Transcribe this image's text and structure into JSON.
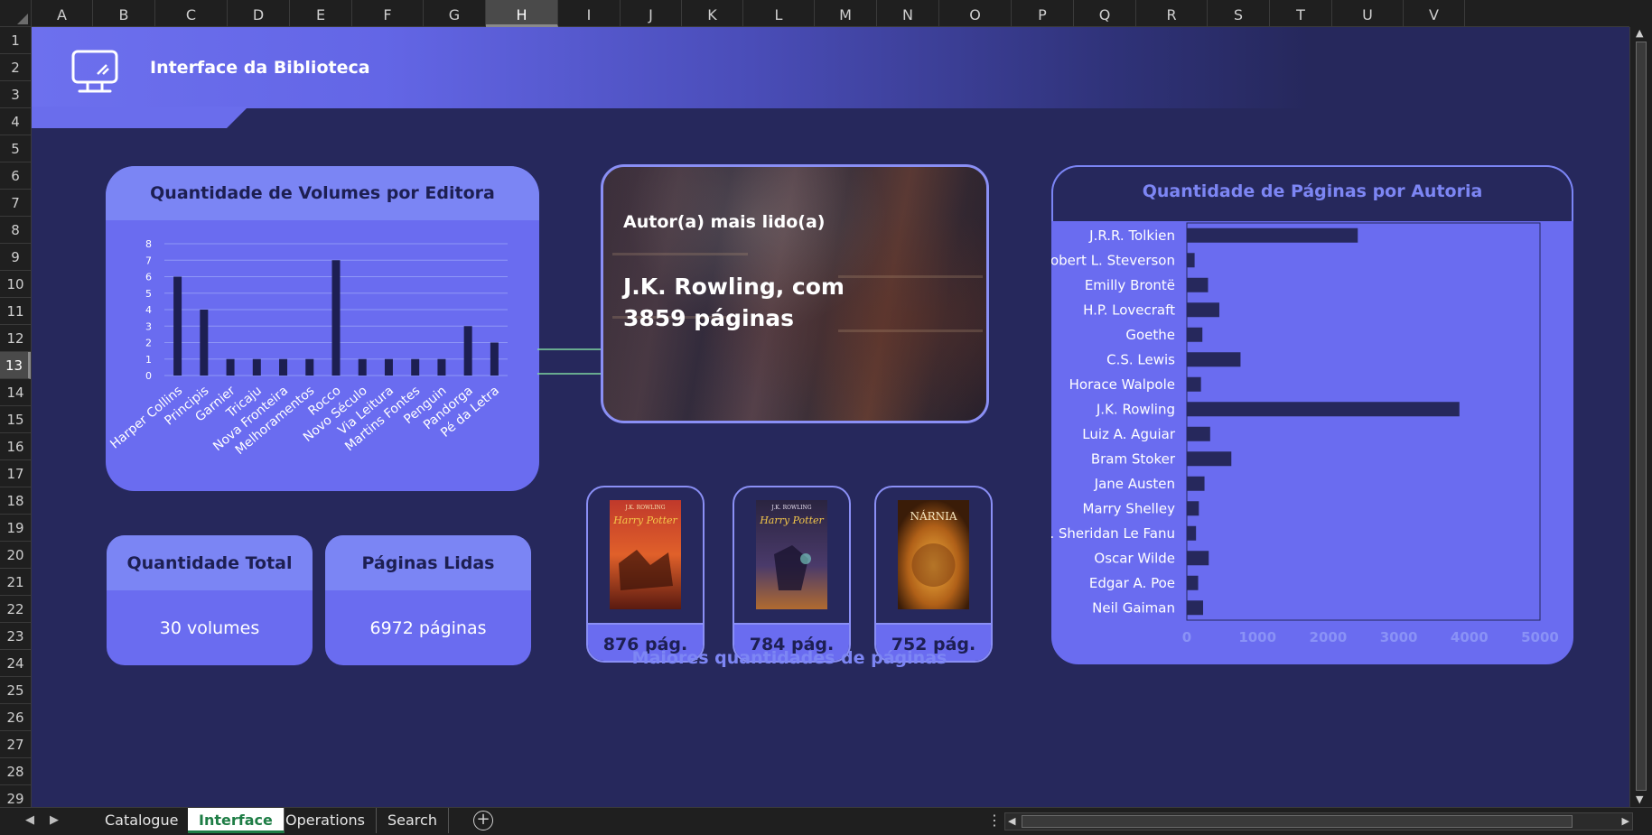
{
  "spreadsheet": {
    "columns": [
      "A",
      "B",
      "C",
      "D",
      "E",
      "F",
      "G",
      "H",
      "I",
      "J",
      "K",
      "L",
      "M",
      "N",
      "O",
      "P",
      "Q",
      "R",
      "S",
      "T",
      "U",
      "V"
    ],
    "selected_column": "H",
    "rows": [
      "1",
      "2",
      "3",
      "4",
      "5",
      "6",
      "7",
      "8",
      "9",
      "10",
      "11",
      "12",
      "13",
      "14",
      "15",
      "16",
      "17",
      "18",
      "19",
      "20",
      "21",
      "22",
      "23",
      "24",
      "25",
      "26",
      "27",
      "28",
      "29"
    ],
    "selected_row": "13"
  },
  "banner": {
    "title": "Interface da Biblioteca",
    "icon": "monitor-icon"
  },
  "volumes_chart": {
    "title": "Quantidade de Volumes por Editora"
  },
  "stats": {
    "total_label": "Quantidade Total",
    "total_value": "30 volumes",
    "pages_label": "Páginas Lidas",
    "pages_value": "6972 páginas"
  },
  "author": {
    "label": "Autor(a) mais lido(a)",
    "value": "J.K. Rowling, com 3859 páginas"
  },
  "books": [
    {
      "pages": "876 pág.",
      "cover_text": "J.K. ROWLING"
    },
    {
      "pages": "784 pág.",
      "cover_text": "J.K. ROWLING"
    },
    {
      "pages": "752 pág.",
      "cover_text": "NÁRNIA"
    }
  ],
  "largest_caption": "Maiores quantidades de páginas",
  "pages_chart": {
    "title": "Quantidade de Páginas por Autoria"
  },
  "chart_data": [
    {
      "type": "bar",
      "title": "Quantidade de Volumes por Editora",
      "categories": [
        "Harper Collins",
        "Principis",
        "Garnier",
        "Tricaju",
        "Nova Fronteira",
        "Melhoramentos",
        "Rocco",
        "Novo Século",
        "Via Leitura",
        "Martins Fontes",
        "Penguin",
        "Pandorga",
        "Pé da Letra"
      ],
      "values": [
        6,
        4,
        1,
        1,
        1,
        1,
        7,
        1,
        1,
        1,
        1,
        3,
        2
      ],
      "yticks": [
        "0",
        "1",
        "2",
        "3",
        "4",
        "5",
        "6",
        "7",
        "8"
      ],
      "ylim": [
        0,
        8
      ],
      "grid": true,
      "color": "#1d1f52"
    },
    {
      "type": "bar",
      "orientation": "horizontal",
      "title": "Quantidade de Páginas por Autoria",
      "categories": [
        "J.R.R. Tolkien",
        "Robert L. Steverson",
        "Emilly Brontë",
        "H.P. Lovecraft",
        "Goethe",
        "C.S. Lewis",
        "Horace Walpole",
        "J.K. Rowling",
        "Luiz A. Aguiar",
        "Bram Stoker",
        "Jane Austen",
        "Marry Shelley",
        "J. Sheridan Le Fanu",
        "Oscar Wilde",
        "Edgar A. Poe",
        "Neil Gaiman"
      ],
      "values": [
        2420,
        110,
        300,
        460,
        220,
        760,
        200,
        3859,
        330,
        630,
        250,
        170,
        130,
        310,
        160,
        230
      ],
      "xticks": [
        "0",
        "1000",
        "2000",
        "3000",
        "4000",
        "5000"
      ],
      "xlim": [
        0,
        5000
      ],
      "color": "#26285c"
    }
  ],
  "tabs": {
    "items": [
      "Catalogue",
      "Interface",
      "Operations",
      "Search"
    ],
    "active": "Interface"
  }
}
